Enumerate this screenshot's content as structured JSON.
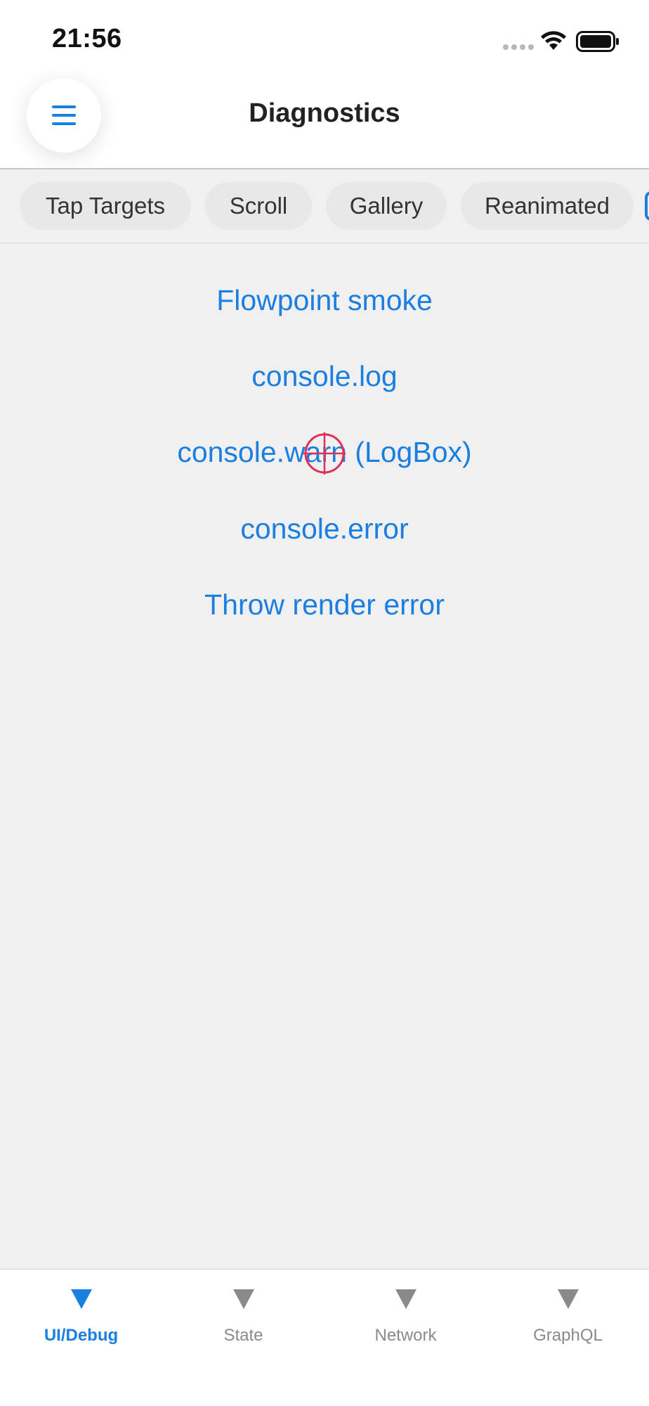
{
  "status_bar": {
    "time": "21:56"
  },
  "header": {
    "title": "Diagnostics",
    "menu_icon": "hamburger-menu-icon"
  },
  "chips": [
    {
      "label": "Tap Targets"
    },
    {
      "label": "Scroll"
    },
    {
      "label": "Gallery"
    },
    {
      "label": "Reanimated"
    }
  ],
  "actions": [
    {
      "label": "Flowpoint smoke"
    },
    {
      "label": "console.log"
    },
    {
      "label": "console.warn (LogBox)"
    },
    {
      "label": "console.error"
    },
    {
      "label": "Throw render error"
    }
  ],
  "tabbar": {
    "tabs": [
      {
        "label": "UI/Debug",
        "icon": "triangle-down-icon",
        "active": true
      },
      {
        "label": "State",
        "icon": "triangle-down-icon",
        "active": false
      },
      {
        "label": "Network",
        "icon": "triangle-down-icon",
        "active": false
      },
      {
        "label": "GraphQL",
        "icon": "triangle-down-icon",
        "active": false
      }
    ]
  },
  "colors": {
    "accent": "#1a7fe0",
    "background": "#f0f0f0",
    "header_bg": "#ffffff",
    "inactive_tab": "#8a8a8a",
    "crosshair": "#e0305a"
  }
}
